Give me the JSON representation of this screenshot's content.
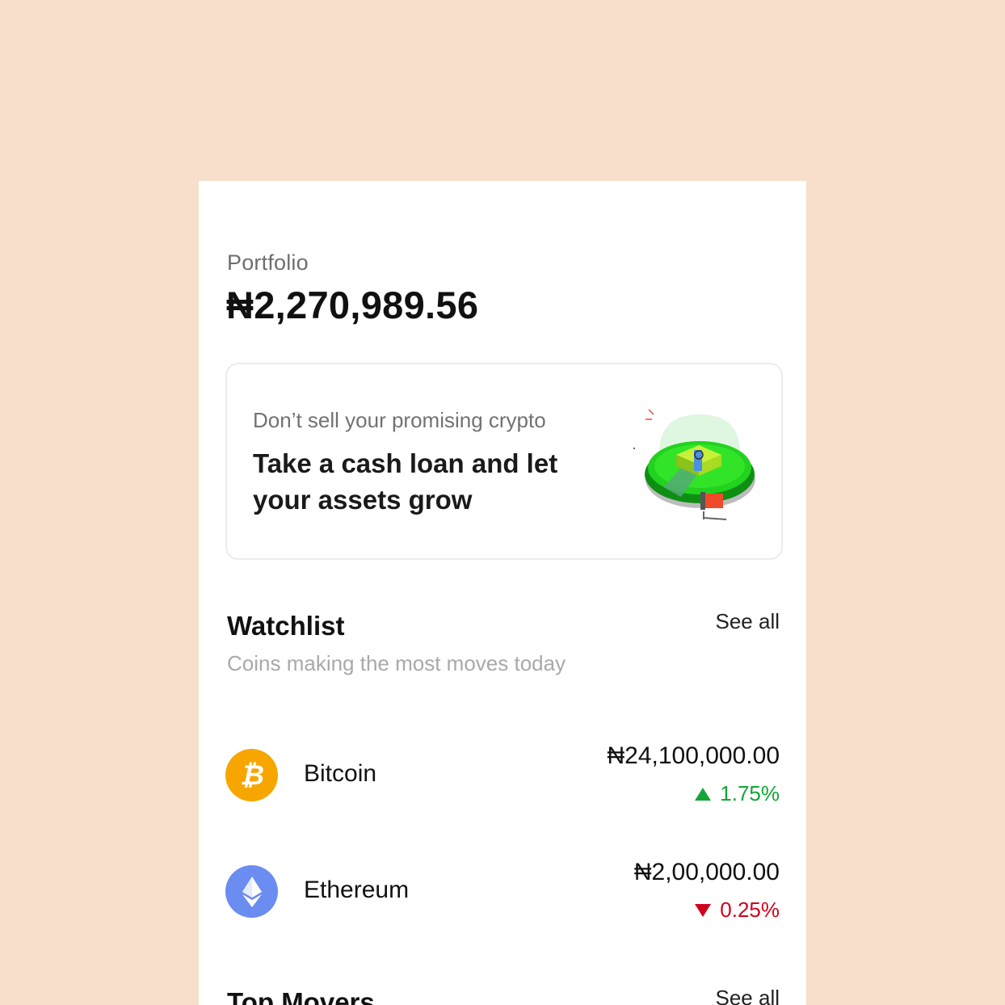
{
  "portfolio": {
    "label": "Portfolio",
    "value": "₦2,270,989.56"
  },
  "promo": {
    "subtitle": "Don’t sell your promising crypto",
    "title": "Take a cash loan and let your assets grow"
  },
  "watchlist": {
    "title": "Watchlist",
    "see_all": "See all",
    "subtitle": "Coins making the most moves today",
    "items": [
      {
        "name": "Bitcoin",
        "price": "₦24,100,000.00",
        "change": "1.75%",
        "direction": "up",
        "icon": "bitcoin-icon",
        "color": "#f7a600"
      },
      {
        "name": "Ethereum",
        "price": "₦2,00,000.00",
        "change": "0.25%",
        "direction": "down",
        "icon": "ethereum-icon",
        "color": "#6b8cf0"
      }
    ]
  },
  "top_movers": {
    "title": "Top Movers",
    "see_all": "See all"
  },
  "colors": {
    "background": "#f7dfcc",
    "positive": "#13a637",
    "negative": "#d0021b"
  }
}
